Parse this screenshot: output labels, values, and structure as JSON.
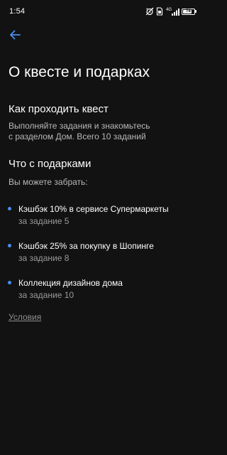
{
  "status_bar": {
    "time": "1:54",
    "network": "4G",
    "battery": "78",
    "battery_level_percent": 78
  },
  "header": {
    "back_icon": "arrow-left-icon"
  },
  "page": {
    "title": "О квесте и подарках",
    "accent_color": "#4a8df0"
  },
  "quest_section": {
    "title": "Как проходить квест",
    "description_line1": "Выполняйте задания и знакомьтесь",
    "description_line2": "с разделом Дом. Всего 10 заданий"
  },
  "gifts_section": {
    "title": "Что с подарками",
    "subtitle": "Вы можете забрать:",
    "items": [
      {
        "title": "Кэшбэк 10% в сервисе Супермаркеты",
        "subtitle": "за задание 5"
      },
      {
        "title": "Кэшбэк 25% за покупку в Шопинге",
        "subtitle": "за задание 8"
      },
      {
        "title": "Коллекция дизайнов дома",
        "subtitle": "за задание 10"
      }
    ]
  },
  "footer": {
    "conditions_link": "Условия"
  }
}
